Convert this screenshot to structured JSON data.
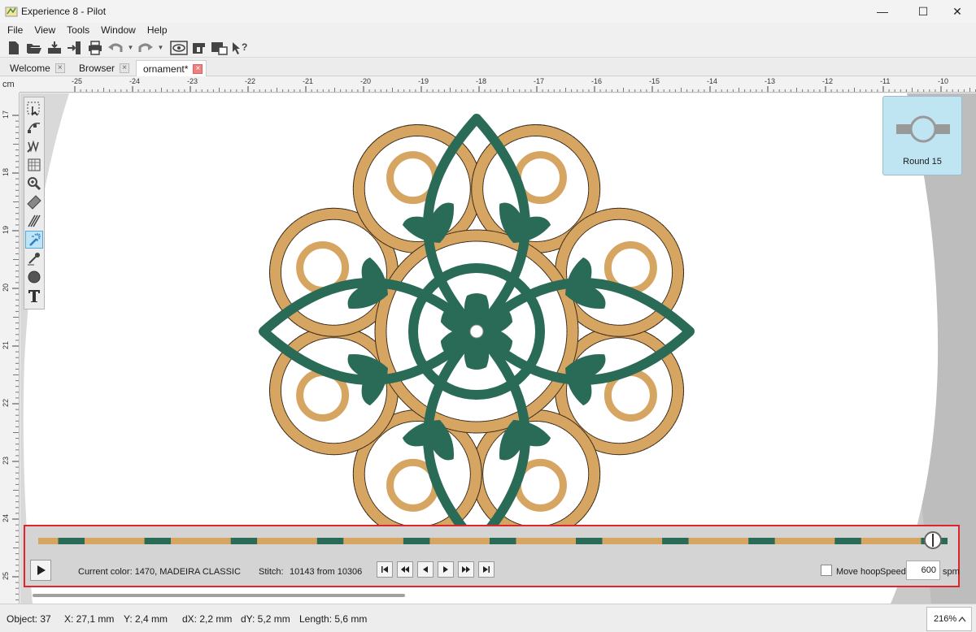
{
  "window": {
    "title": "Experience 8 - Pilot",
    "minimize": "—",
    "maximize": "☐",
    "close": "✕"
  },
  "menu": {
    "items": [
      "File",
      "View",
      "Tools",
      "Window",
      "Help"
    ]
  },
  "tabs": [
    {
      "label": "Welcome",
      "close": "×"
    },
    {
      "label": "Browser",
      "close": "×"
    },
    {
      "label": "ornament*",
      "close": "×"
    }
  ],
  "ruler": {
    "unit": "cm",
    "top_labels": [
      "-25",
      "-24",
      "-23",
      "-22",
      "-21",
      "-20",
      "-19",
      "-18",
      "-17",
      "-16",
      "-15",
      "-14",
      "-13",
      "-12",
      "-11",
      "-10"
    ],
    "left_labels": [
      "17",
      "18",
      "19",
      "20",
      "21",
      "22",
      "23",
      "24",
      "25"
    ]
  },
  "color_thumbnail": {
    "label": "Round 15",
    "color": "#bfe4f2"
  },
  "simulator": {
    "current_color_label": "Current color: 1470, MADEIRA CLASSIC",
    "stitch_label": "Stitch:",
    "stitch_value": "10143 from 10306",
    "progress": 0.984,
    "move_hoop_label": "Move hoop",
    "speed_label": "Speed:",
    "speed_value": "600",
    "speed_unit": "spm"
  },
  "status": {
    "object": "Object: 37",
    "x": "X: 27,1 mm",
    "y": "Y: 2,4 mm",
    "dx": "dX: 2,2 mm",
    "dy": "dY: 5,2 mm",
    "length": "Length: 5,6 mm",
    "zoom": "216%"
  },
  "colors": {
    "gold": "#d7a562",
    "green": "#2a6b57",
    "highlight": "#e0242b"
  }
}
